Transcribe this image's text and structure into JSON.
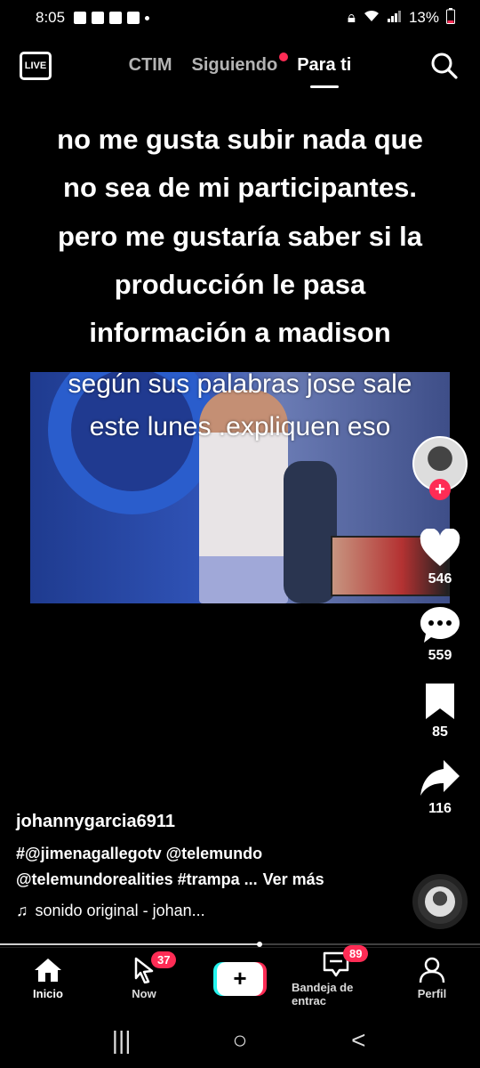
{
  "status_bar": {
    "time": "8:05",
    "battery": "13%"
  },
  "top_nav": {
    "live_label": "LIVE",
    "tabs": [
      {
        "label": "CTIM"
      },
      {
        "label": "Siguiendo"
      },
      {
        "label": "Para ti"
      }
    ],
    "active_tab": "Para ti"
  },
  "video": {
    "caption_lines": [
      "no me gusta subir nada que",
      "no sea de mi participantes.",
      "pero me gustaría saber si la",
      "producción le pasa",
      "información a madison"
    ],
    "overlay_lines": [
      "según sus palabras jose sale",
      "este lunes .expliquen eso"
    ]
  },
  "actions": {
    "likes": "546",
    "comments": "559",
    "bookmarks": "85",
    "shares": "116"
  },
  "post": {
    "username": "johannygarcia6911",
    "desc_line1": "#@jimenagallegotv @telemundo",
    "desc_line2": "@telemundorealities #trampa ...",
    "see_more": "Ver más",
    "sound": "sonido original - johan..."
  },
  "progress": 0.54,
  "bottom_nav": {
    "items": [
      {
        "label": "Inicio"
      },
      {
        "label": "Now",
        "badge": "37"
      },
      {
        "label": ""
      },
      {
        "label": "Bandeja de entrac",
        "badge": "89"
      },
      {
        "label": "Perfil"
      }
    ],
    "create_symbol": "+"
  },
  "system_nav": {
    "recents": "|||",
    "home": "○",
    "back": "<"
  },
  "colors": {
    "accent": "#fe2c55",
    "cyan": "#25f4ee"
  }
}
